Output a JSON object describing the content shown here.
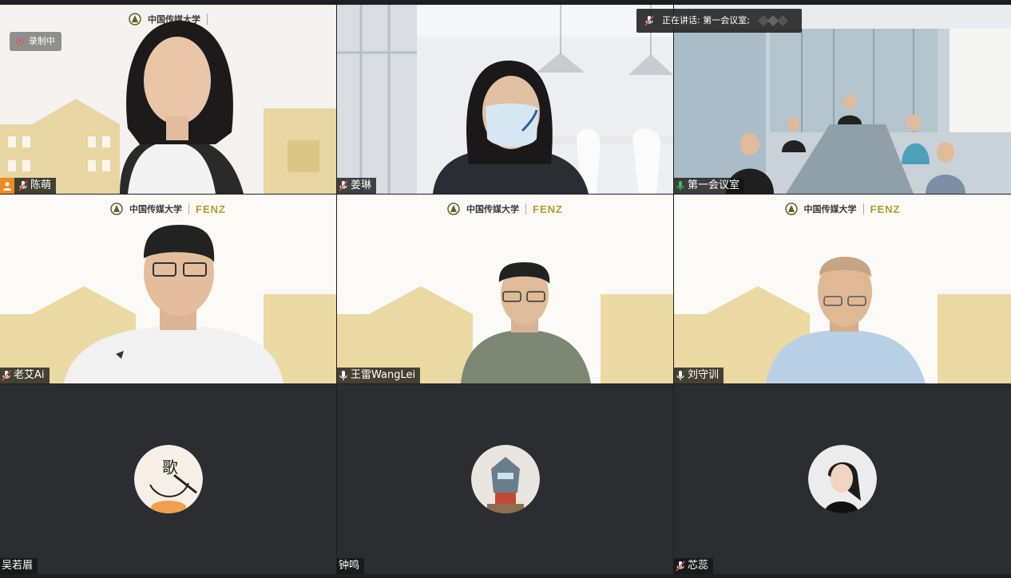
{
  "recording": {
    "label": "录制中"
  },
  "speaking": {
    "label": "正在讲话: 第一会议室;"
  },
  "logo": {
    "fenz": "FENZ"
  },
  "tiles": [
    {
      "name": "陈萌",
      "type": "video",
      "mic": "muted",
      "host": true
    },
    {
      "name": "姜琳",
      "type": "video",
      "mic": "muted"
    },
    {
      "name": "第一会议室",
      "type": "video",
      "mic": "active"
    },
    {
      "name": "老艾Ai",
      "type": "video",
      "mic": "muted"
    },
    {
      "name": "王雷WangLei",
      "type": "video",
      "mic": "on"
    },
    {
      "name": "刘守训",
      "type": "video",
      "mic": "on"
    },
    {
      "name": "吴若眉",
      "type": "avatar",
      "mic": "none"
    },
    {
      "name": "钟鸣",
      "type": "avatar",
      "mic": "none"
    },
    {
      "name": "芯蕊",
      "type": "avatar",
      "mic": "muted"
    }
  ],
  "colors": {
    "accent_green": "#3fbf5a",
    "muted_red": "#e0524c",
    "host_orange": "#f08a24",
    "gold": "#c9ad55"
  }
}
